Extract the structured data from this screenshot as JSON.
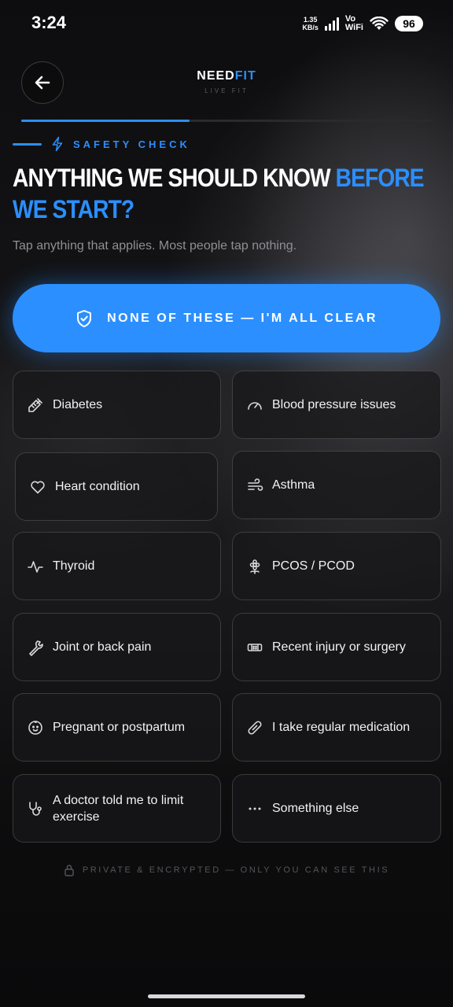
{
  "status_bar": {
    "time": "3:24",
    "net_speed_value": "1.35",
    "net_speed_unit": "KB/s",
    "vo_label": "Vo",
    "wifi_label": "WiFi",
    "battery": "96"
  },
  "header": {
    "brand_part1": "NEED",
    "brand_part2": "FIT",
    "brand_tagline": "LIVE FIT",
    "progress_fraction": 0.41
  },
  "eyebrow": "SAFETY CHECK",
  "headline": {
    "main": "ANYTHING WE SHOULD KNOW ",
    "accent": "BEFORE WE START?"
  },
  "subtitle": "Tap anything that applies. Most people tap nothing.",
  "clear_button_label": "NONE OF THESE — I'M ALL CLEAR",
  "options": [
    {
      "label": "Diabetes",
      "icon": "syringe-icon"
    },
    {
      "label": "Blood pressure issues",
      "icon": "gauge-icon"
    },
    {
      "label": "Heart condition",
      "icon": "heart-icon"
    },
    {
      "label": "Asthma",
      "icon": "wind-icon"
    },
    {
      "label": "Thyroid",
      "icon": "pulse-icon"
    },
    {
      "label": "PCOS / PCOD",
      "icon": "flower-icon"
    },
    {
      "label": "Joint or back pain",
      "icon": "wrench-icon"
    },
    {
      "label": "Recent injury or surgery",
      "icon": "bandage-icon"
    },
    {
      "label": "Pregnant or postpartum",
      "icon": "baby-icon"
    },
    {
      "label": "I take regular medication",
      "icon": "pill-icon"
    },
    {
      "label": "A doctor told me to limit exercise",
      "icon": "stethoscope-icon"
    },
    {
      "label": "Something else",
      "icon": "more-icon"
    }
  ],
  "footer": "PRIVATE & ENCRYPTED — ONLY YOU CAN SEE THIS",
  "colors": {
    "accent": "#2b8fff",
    "background": "#0a0a0b",
    "card_border": "#3a3a3e"
  }
}
